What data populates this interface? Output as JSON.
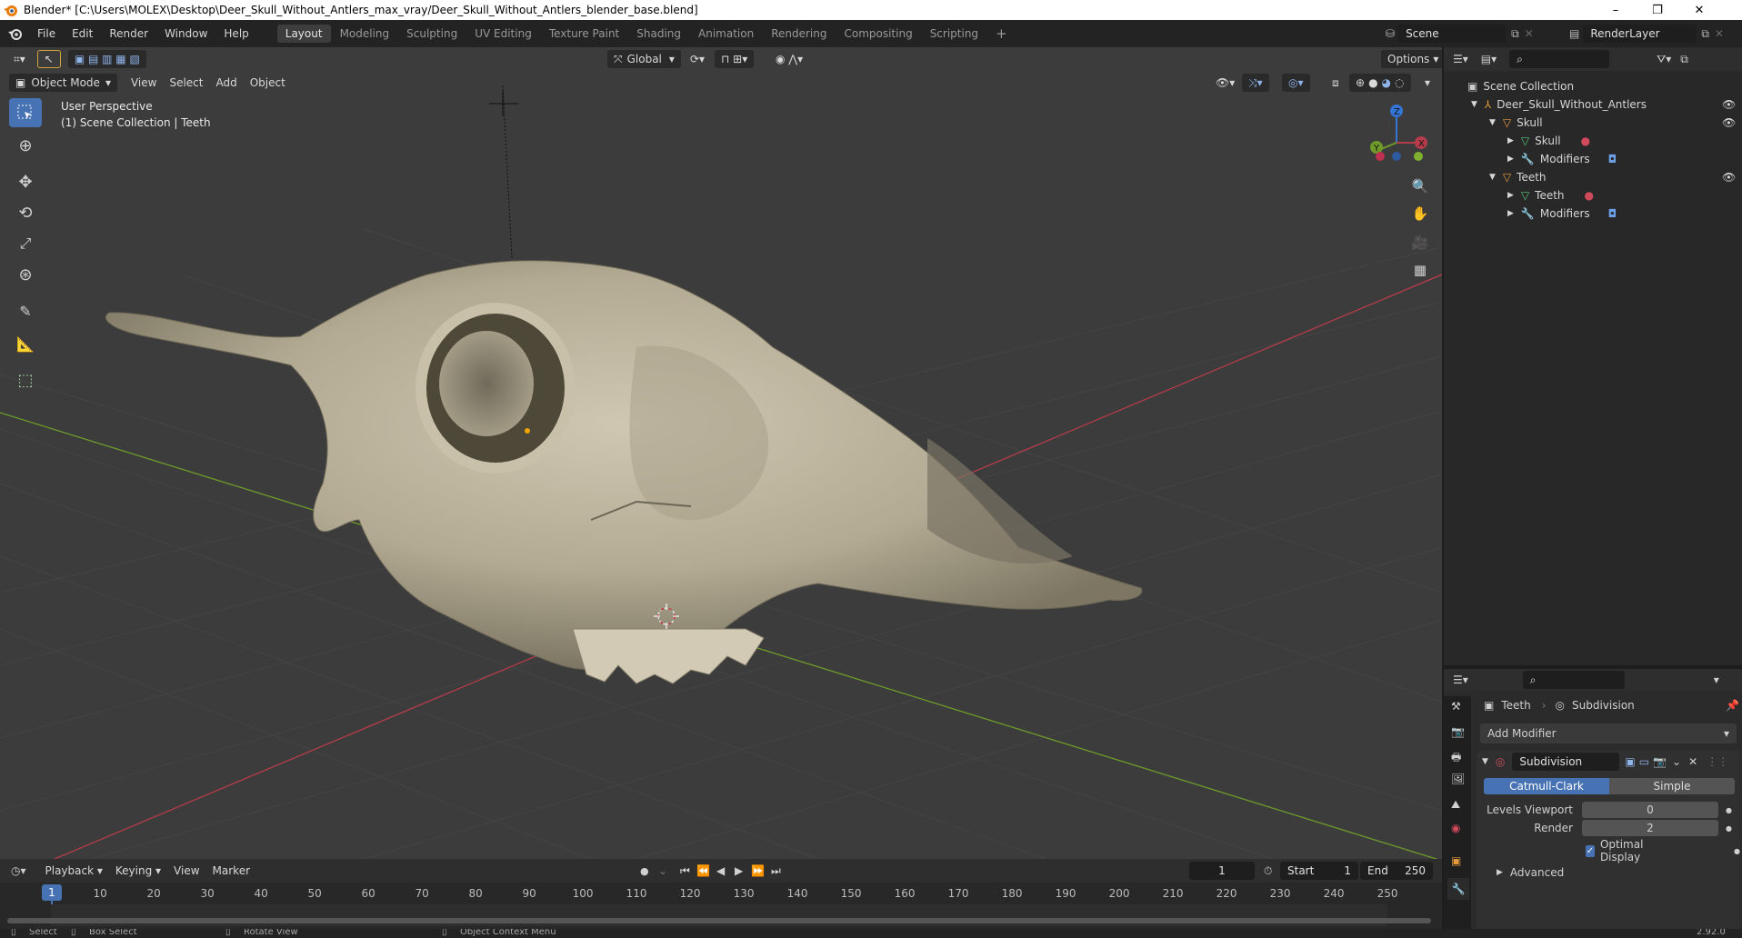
{
  "window": {
    "title": "Blender* [C:\\Users\\MOLEX\\Desktop\\Deer_Skull_Without_Antlers_max_vray/Deer_Skull_Without_Antlers_blender_base.blend]",
    "controls": [
      "–",
      "❐",
      "✕"
    ]
  },
  "menu": [
    "File",
    "Edit",
    "Render",
    "Window",
    "Help"
  ],
  "workspaces": [
    {
      "label": "Layout",
      "active": true
    },
    {
      "label": "Modeling"
    },
    {
      "label": "Sculpting"
    },
    {
      "label": "UV Editing"
    },
    {
      "label": "Texture Paint"
    },
    {
      "label": "Shading"
    },
    {
      "label": "Animation"
    },
    {
      "label": "Rendering"
    },
    {
      "label": "Compositing"
    },
    {
      "label": "Scripting"
    }
  ],
  "scene": {
    "name": "Scene",
    "render_layer": "RenderLayer"
  },
  "viewport": {
    "orientation": "Global",
    "options_label": "Options",
    "mode": "Object Mode",
    "menus": [
      "View",
      "Select",
      "Add",
      "Object"
    ],
    "overlay_title": "User Perspective",
    "overlay_subtitle": "(1) Scene Collection | Teeth",
    "gizmo": {
      "x": "X",
      "y": "Y",
      "z": "Z"
    }
  },
  "outliner": {
    "root": "Scene Collection",
    "items": [
      {
        "label": "Deer_Skull_Without_Antlers",
        "depth": 1,
        "icon": "empty"
      },
      {
        "label": "Skull",
        "depth": 2,
        "icon": "object"
      },
      {
        "label": "Skull",
        "depth": 3,
        "icon": "mesh"
      },
      {
        "label": "Modifiers",
        "depth": 3,
        "icon": "wrench"
      },
      {
        "label": "Teeth",
        "depth": 2,
        "icon": "object"
      },
      {
        "label": "Teeth",
        "depth": 3,
        "icon": "mesh"
      },
      {
        "label": "Modifiers",
        "depth": 3,
        "icon": "wrench"
      }
    ]
  },
  "properties": {
    "breadcrumb_object": "Teeth",
    "breadcrumb_modifier": "Subdivision",
    "add_modifier": "Add Modifier",
    "modifier_name": "Subdivision",
    "mode_catmull": "Catmull-Clark",
    "mode_simple": "Simple",
    "levels_viewport_label": "Levels Viewport",
    "levels_viewport_value": "0",
    "render_label": "Render",
    "render_value": "2",
    "optimal_display": "Optimal Display",
    "advanced": "Advanced"
  },
  "timeline": {
    "menus": [
      "Playback",
      "Keying",
      "View",
      "Marker"
    ],
    "current_frame": "1",
    "start_label": "Start",
    "start_value": "1",
    "end_label": "End",
    "end_value": "250",
    "ticks": [
      "1",
      "10",
      "20",
      "30",
      "40",
      "50",
      "60",
      "70",
      "80",
      "90",
      "100",
      "110",
      "120",
      "130",
      "140",
      "150",
      "160",
      "170",
      "180",
      "190",
      "200",
      "210",
      "220",
      "230",
      "240",
      "250"
    ]
  },
  "status": {
    "select": "Select",
    "box_select": "Box Select",
    "rotate_view": "Rotate View",
    "context_menu": "Object Context Menu",
    "version": "2.92.0"
  },
  "colors": {
    "accent": "#4772b3",
    "x_axis": "#b53c4a",
    "y_axis": "#6e9a2a",
    "z_axis": "#3474d4"
  }
}
